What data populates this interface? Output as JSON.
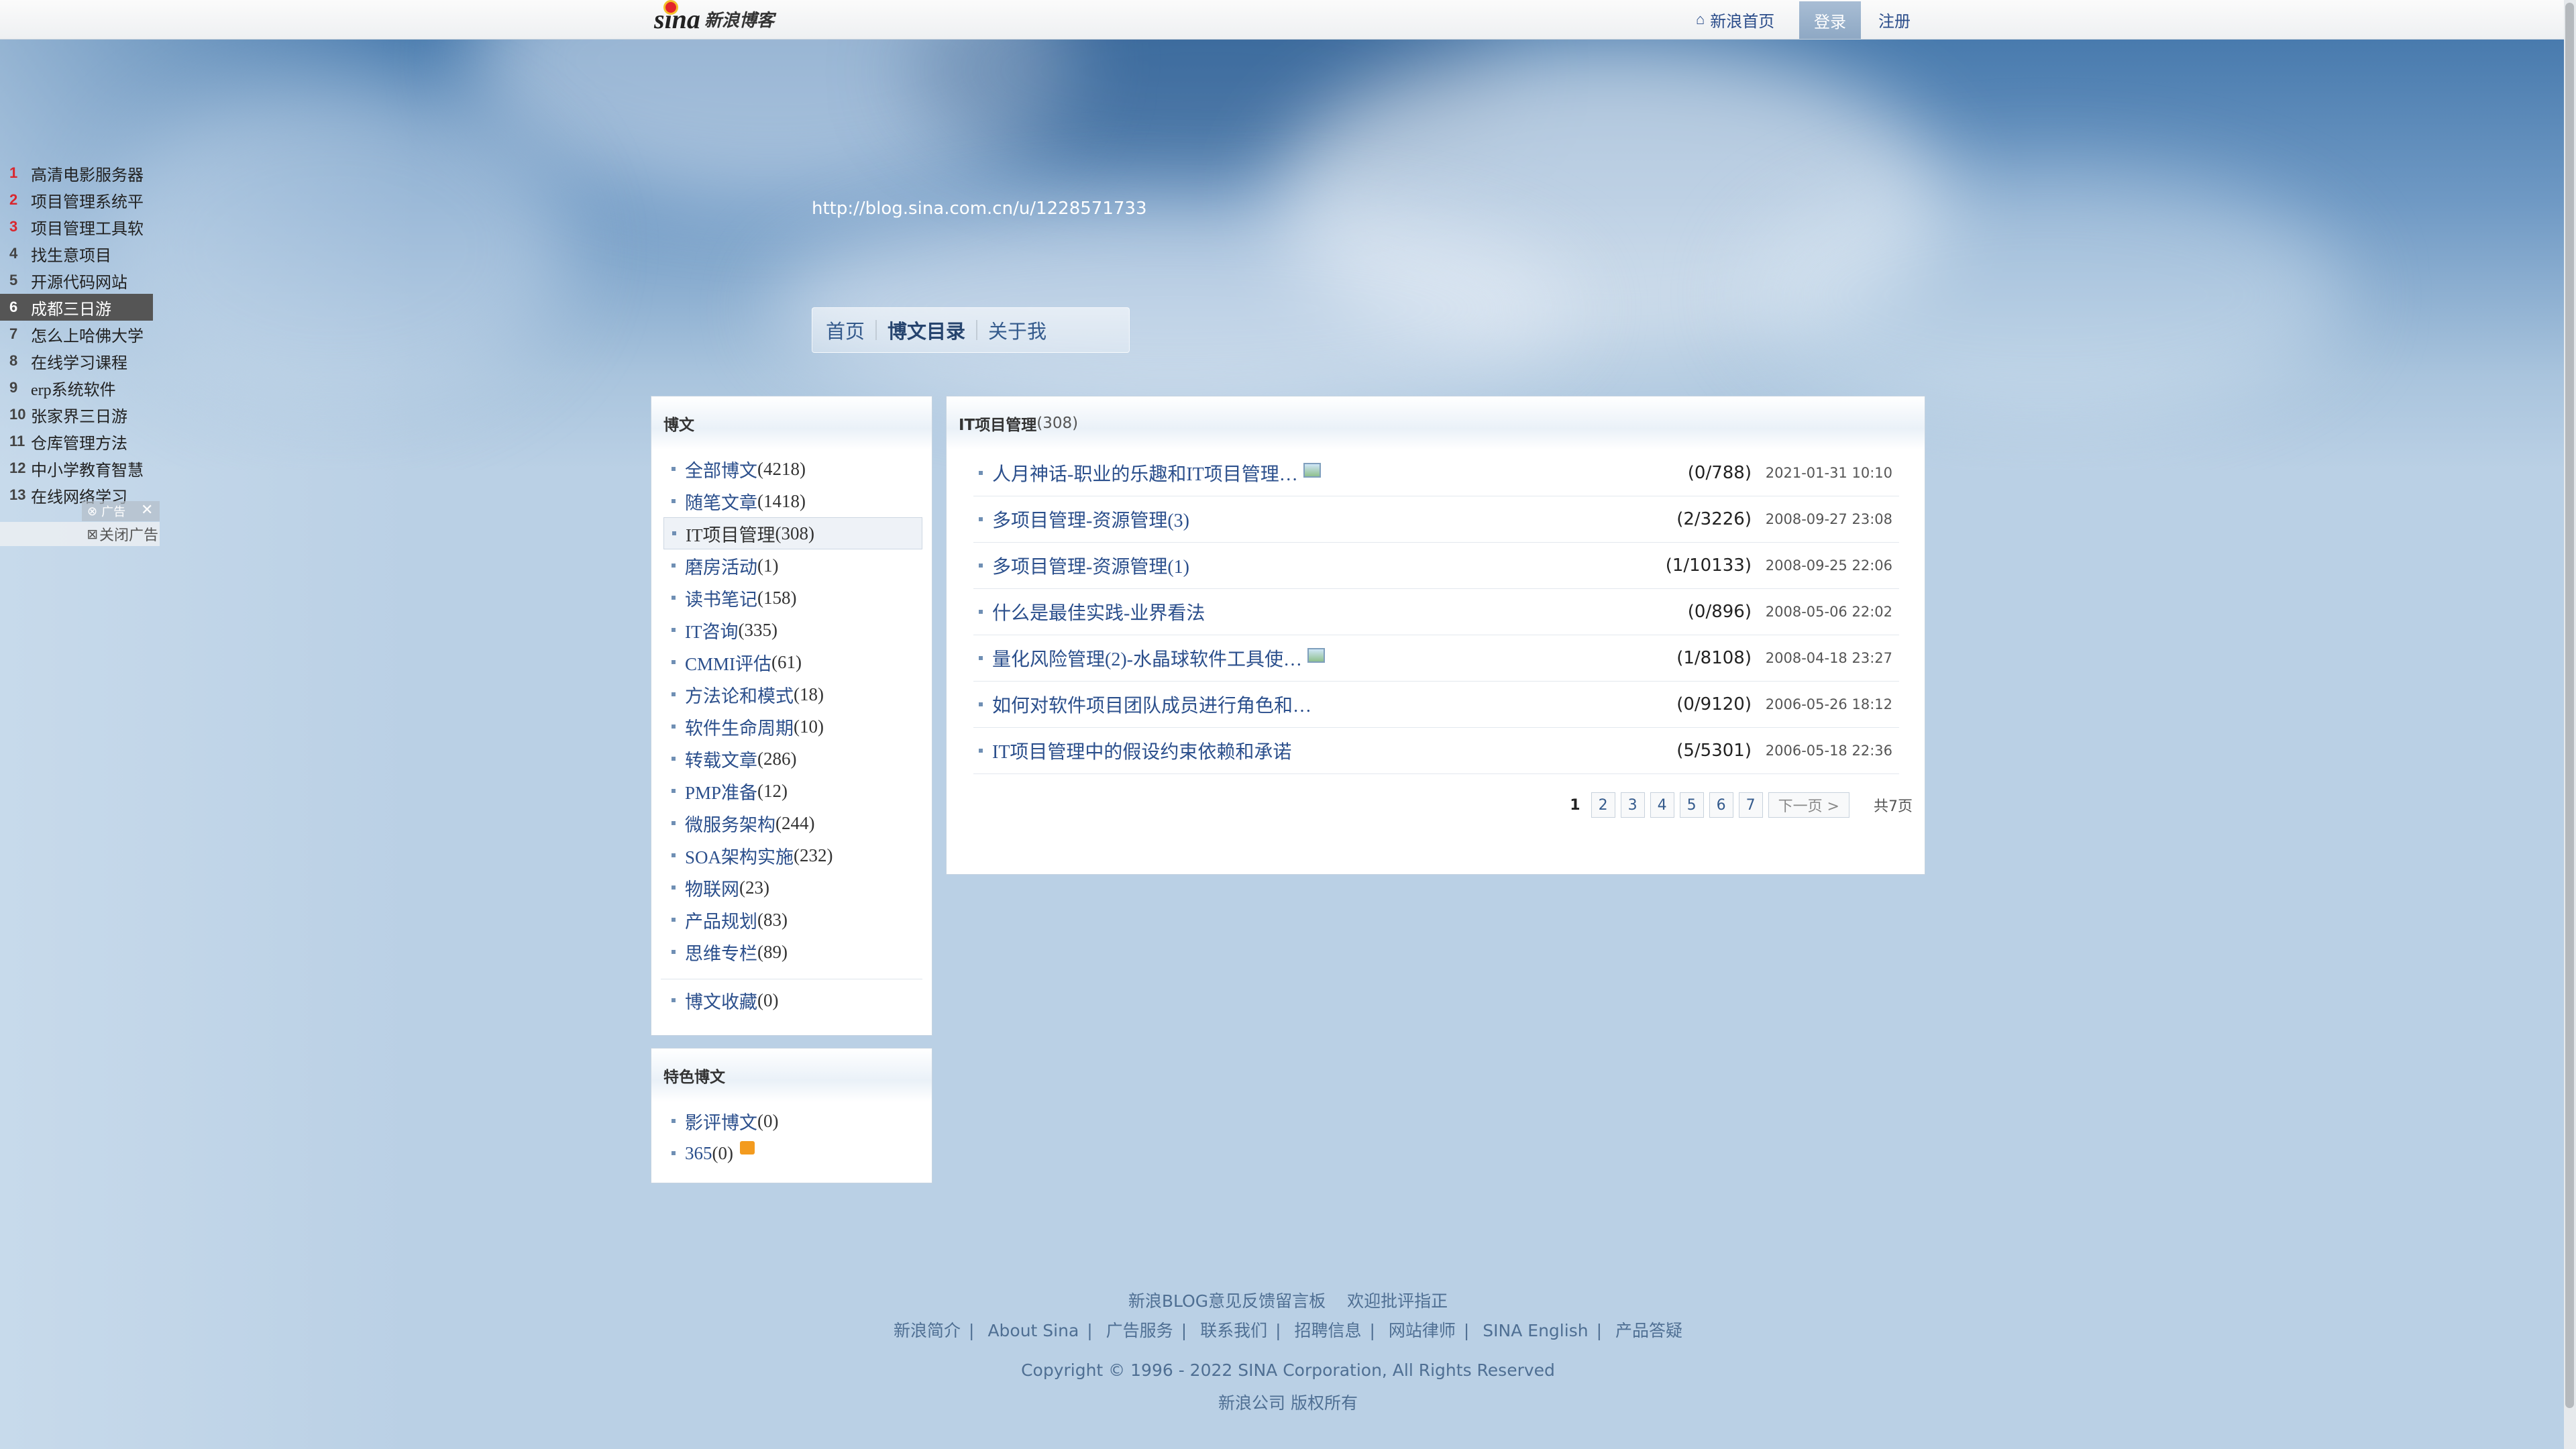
{
  "topbar": {
    "logo_sina": "sina",
    "logo_text": "新浪博客",
    "home_link": "新浪首页",
    "login": "登录",
    "register": "注册"
  },
  "hot_list": [
    {
      "num": "1",
      "text": "高清电影服务器"
    },
    {
      "num": "2",
      "text": "项目管理系统平"
    },
    {
      "num": "3",
      "text": "项目管理工具软"
    },
    {
      "num": "4",
      "text": "找生意项目"
    },
    {
      "num": "5",
      "text": "开源代码网站"
    },
    {
      "num": "6",
      "text": "成都三日游"
    },
    {
      "num": "7",
      "text": "怎么上哈佛大学"
    },
    {
      "num": "8",
      "text": "在线学习课程"
    },
    {
      "num": "9",
      "text": "erp系统软件"
    },
    {
      "num": "10",
      "text": "张家界三日游"
    },
    {
      "num": "11",
      "text": "仓库管理方法"
    },
    {
      "num": "12",
      "text": "中小学教育智慧"
    },
    {
      "num": "13",
      "text": "在线网络学习"
    }
  ],
  "ad": {
    "tag": "广告",
    "close": "关闭广告"
  },
  "blog_url": "http://blog.sina.com.cn/u/1228571733",
  "nav": {
    "home": "首页",
    "catalog": "博文目录",
    "about": "关于我"
  },
  "categories_panel": {
    "title": "博文",
    "items": [
      {
        "name": "全部博文",
        "count": "(4218)"
      },
      {
        "name": "随笔文章",
        "count": "(1418)"
      },
      {
        "name": "IT项目管理",
        "count": "(308)"
      },
      {
        "name": "磨房活动",
        "count": "(1)"
      },
      {
        "name": "读书笔记",
        "count": "(158)"
      },
      {
        "name": "IT咨询",
        "count": "(335)"
      },
      {
        "name": "CMMI评估",
        "count": "(61)"
      },
      {
        "name": "方法论和模式",
        "count": "(18)"
      },
      {
        "name": "软件生命周期",
        "count": "(10)"
      },
      {
        "name": "转载文章",
        "count": "(286)"
      },
      {
        "name": "PMP准备",
        "count": "(12)"
      },
      {
        "name": "微服务架构",
        "count": "(244)"
      },
      {
        "name": "SOA架构实施",
        "count": "(232)"
      },
      {
        "name": "物联网",
        "count": "(23)"
      },
      {
        "name": "产品规划",
        "count": "(83)"
      },
      {
        "name": "思维专栏",
        "count": "(89)"
      }
    ],
    "favorites": {
      "name": "博文收藏",
      "count": "(0)"
    }
  },
  "featured_panel": {
    "title": "特色博文",
    "items": [
      {
        "name": "影评博文",
        "count": "(0)"
      },
      {
        "name": "365",
        "count": "(0)"
      }
    ]
  },
  "main": {
    "title": "IT项目管理",
    "title_count": "(308)",
    "posts": [
      {
        "title": "人月神话-职业的乐趣和IT项目管理…",
        "has_image": true,
        "count": "(0/788)",
        "date": "2021-01-31 10:10"
      },
      {
        "title": "多项目管理-资源管理(3)",
        "has_image": false,
        "count": "(2/3226)",
        "date": "2008-09-27 23:08"
      },
      {
        "title": "多项目管理-资源管理(1)",
        "has_image": false,
        "count": "(1/10133)",
        "date": "2008-09-25 22:06"
      },
      {
        "title": "什么是最佳实践-业界看法",
        "has_image": false,
        "count": "(0/896)",
        "date": "2008-05-06 22:02"
      },
      {
        "title": "量化风险管理(2)-水晶球软件工具使…",
        "has_image": true,
        "count": "(1/8108)",
        "date": "2008-04-18 23:27"
      },
      {
        "title": "如何对软件项目团队成员进行角色和…",
        "has_image": false,
        "count": "(0/9120)",
        "date": "2006-05-26 18:12"
      },
      {
        "title": "IT项目管理中的假设约束依赖和承诺",
        "has_image": false,
        "count": "(5/5301)",
        "date": "2006-05-18 22:36"
      }
    ],
    "pager": {
      "current": "1",
      "pages": [
        "2",
        "3",
        "4",
        "5",
        "6",
        "7"
      ],
      "next": "下一页 >",
      "total": "共7页"
    }
  },
  "footer": {
    "line1": [
      "新浪BLOG意见反馈留言板",
      "欢迎批评指正"
    ],
    "line2": [
      "新浪简介",
      "About Sina",
      "广告服务",
      "联系我们",
      "招聘信息",
      "网站律师",
      "SINA English",
      "产品答疑"
    ],
    "copyright": "Copyright © 1996 - 2022 SINA Corporation, All Rights Reserved",
    "rights": "新浪公司 版权所有"
  },
  "colors": {
    "link": "#2b4f8c",
    "hot_red": "#d9272e",
    "background": "#bad0e5"
  }
}
